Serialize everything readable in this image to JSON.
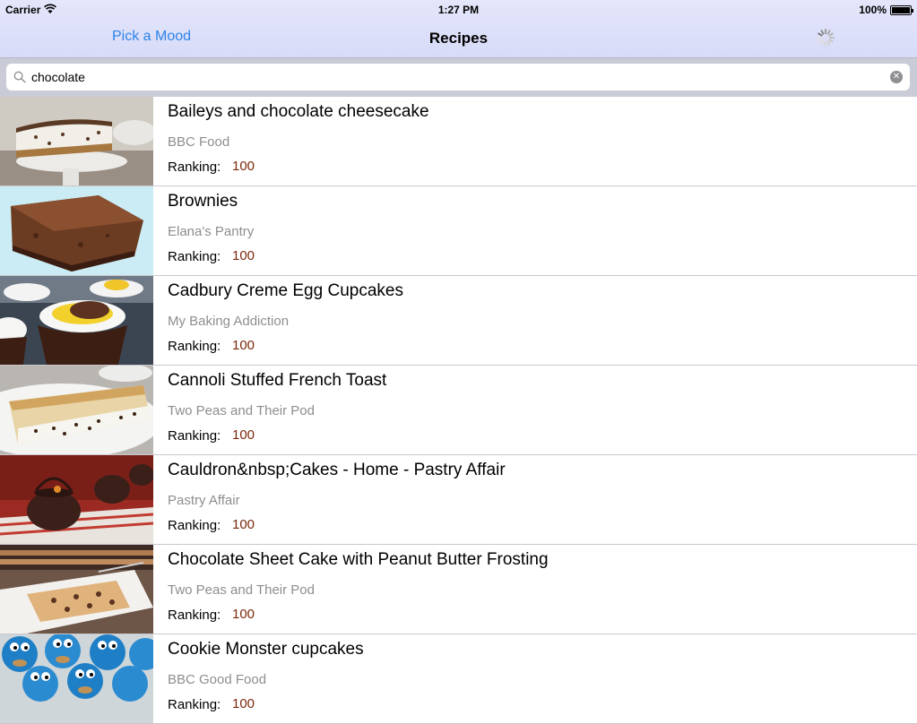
{
  "status": {
    "carrier": "Carrier",
    "time": "1:27 PM",
    "battery": "100%"
  },
  "nav": {
    "left_button": "Pick a Mood",
    "title": "Recipes",
    "activity_icon": "spinner-icon"
  },
  "search": {
    "value": "chocolate",
    "search_icon": "search-icon",
    "clear_icon": "clear-icon"
  },
  "recipes": [
    {
      "title": "Baileys and chocolate cheesecake",
      "source": "BBC Food",
      "ranking_label": "Ranking:",
      "ranking": "100"
    },
    {
      "title": "Brownies",
      "source": "Elana's Pantry",
      "ranking_label": "Ranking:",
      "ranking": "100"
    },
    {
      "title": "Cadbury Creme Egg Cupcakes",
      "source": "My Baking Addiction",
      "ranking_label": "Ranking:",
      "ranking": "100"
    },
    {
      "title": "Cannoli Stuffed French Toast",
      "source": "Two Peas and Their Pod",
      "ranking_label": "Ranking:",
      "ranking": "100"
    },
    {
      "title": "Cauldron&nbsp;Cakes - Home - Pastry Affair",
      "source": "Pastry Affair",
      "ranking_label": "Ranking:",
      "ranking": "100"
    },
    {
      "title": "Chocolate Sheet Cake with Peanut Butter Frosting",
      "source": "Two Peas and Their Pod",
      "ranking_label": "Ranking:",
      "ranking": "100"
    },
    {
      "title": "Cookie Monster cupcakes",
      "source": "BBC Good Food",
      "ranking_label": "Ranking:",
      "ranking": "100"
    }
  ],
  "colors": {
    "nav_background": "#dcdff9",
    "accent": "#2d84e8",
    "ranking_value": "#7a2a0b",
    "secondary_text": "#8e8e8e"
  }
}
